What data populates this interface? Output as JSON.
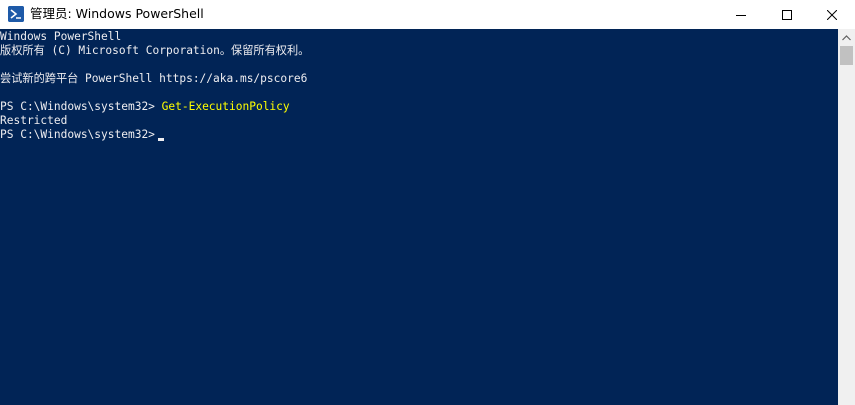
{
  "window": {
    "title": "管理员: Windows PowerShell"
  },
  "console": {
    "lines": [
      "Windows PowerShell",
      "版权所有 (C) Microsoft Corporation。保留所有权利。",
      "",
      "尝试新的跨平台 PowerShell https://aka.ms/pscore6",
      "",
      "PS C:\\Windows\\system32> ",
      "Restricted",
      "PS C:\\Windows\\system32>"
    ],
    "command": "Get-ExecutionPolicy",
    "background_color": "#012456",
    "text_color": "#eeedf0",
    "command_color": "#ffff00"
  },
  "icons": {
    "app": "powershell-icon",
    "minimize": "minimize-icon",
    "maximize": "maximize-icon",
    "close": "close-icon",
    "scroll_up": "chevron-up-icon"
  }
}
